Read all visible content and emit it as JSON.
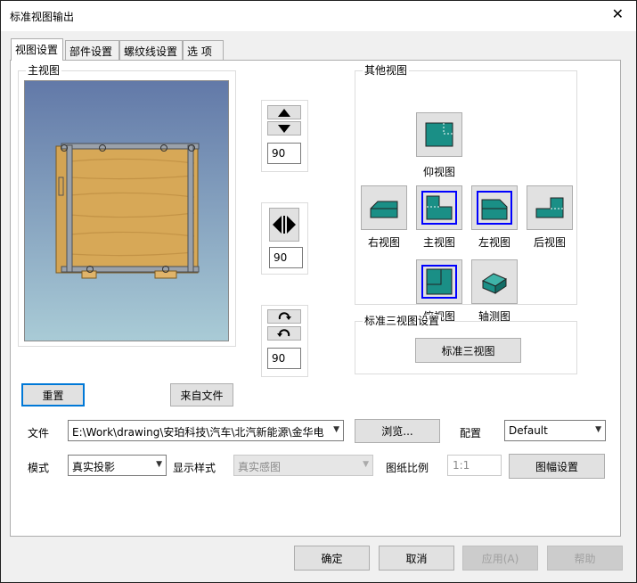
{
  "window": {
    "title": "标准视图输出",
    "close_glyph": "✕"
  },
  "tabs": [
    {
      "label": "视图设置",
      "active": true
    },
    {
      "label": "部件设置",
      "active": false
    },
    {
      "label": "螺纹线设置",
      "active": false
    },
    {
      "label": "选 项",
      "active": false
    }
  ],
  "main_view": {
    "group_label": "主视图",
    "reset_label": "重置",
    "from_file_label": "来自文件"
  },
  "rotation": {
    "vertical_value": "90",
    "horizontal_value": "90",
    "spin_value": "90",
    "icons": [
      "up-arrow-icon",
      "down-arrow-icon",
      "left-arrow-icon",
      "right-arrow-icon",
      "rotate-cw-icon",
      "rotate-ccw-icon"
    ]
  },
  "other_views": {
    "group_label": "其他视图",
    "bottom": "仰视图",
    "right": "右视图",
    "front": "主视图",
    "left": "左视图",
    "back": "后视图",
    "top": "俯视图",
    "iso": "轴测图"
  },
  "standard_three": {
    "group_label": "标准三视图设置",
    "button_label": "标准三视图"
  },
  "file_row": {
    "file_label": "文件",
    "file_value": "E:\\Work\\drawing\\安珀科技\\汽车\\北汽新能源\\金华电",
    "browse_label": "浏览...",
    "config_label": "配置",
    "config_value": "Default"
  },
  "mode_row": {
    "mode_label": "模式",
    "mode_value": "真实投影",
    "display_label": "显示样式",
    "display_value": "真实感图",
    "scale_label": "图纸比例",
    "scale_value": "1:1",
    "sheet_button": "图幅设置"
  },
  "footer": {
    "ok": "确定",
    "cancel": "取消",
    "apply": "应用(A)",
    "help": "帮助"
  },
  "colors": {
    "tile_teal": "#1a8f86",
    "selection_blue": "#0000ff",
    "focus_blue": "#0078d7",
    "wood": "#d9ab5a"
  }
}
